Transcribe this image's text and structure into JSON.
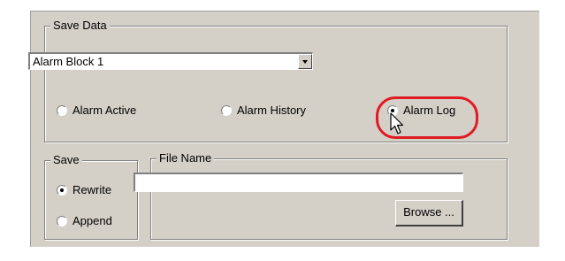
{
  "save_data": {
    "legend": "Save Data",
    "block_select": {
      "value": "Alarm Block 1"
    },
    "options": [
      {
        "label": "Alarm Active",
        "selected": false
      },
      {
        "label": "Alarm History",
        "selected": false
      },
      {
        "label": "Alarm Log",
        "selected": true
      }
    ]
  },
  "save_mode": {
    "legend": "Save",
    "options": [
      {
        "label": "Rewrite",
        "selected": true
      },
      {
        "label": "Append",
        "selected": false
      }
    ]
  },
  "file_name": {
    "legend": "File Name",
    "value": "",
    "browse_label": "Browse ..."
  },
  "colors": {
    "highlight": "#e01b24",
    "panel": "#d4d0c8"
  }
}
